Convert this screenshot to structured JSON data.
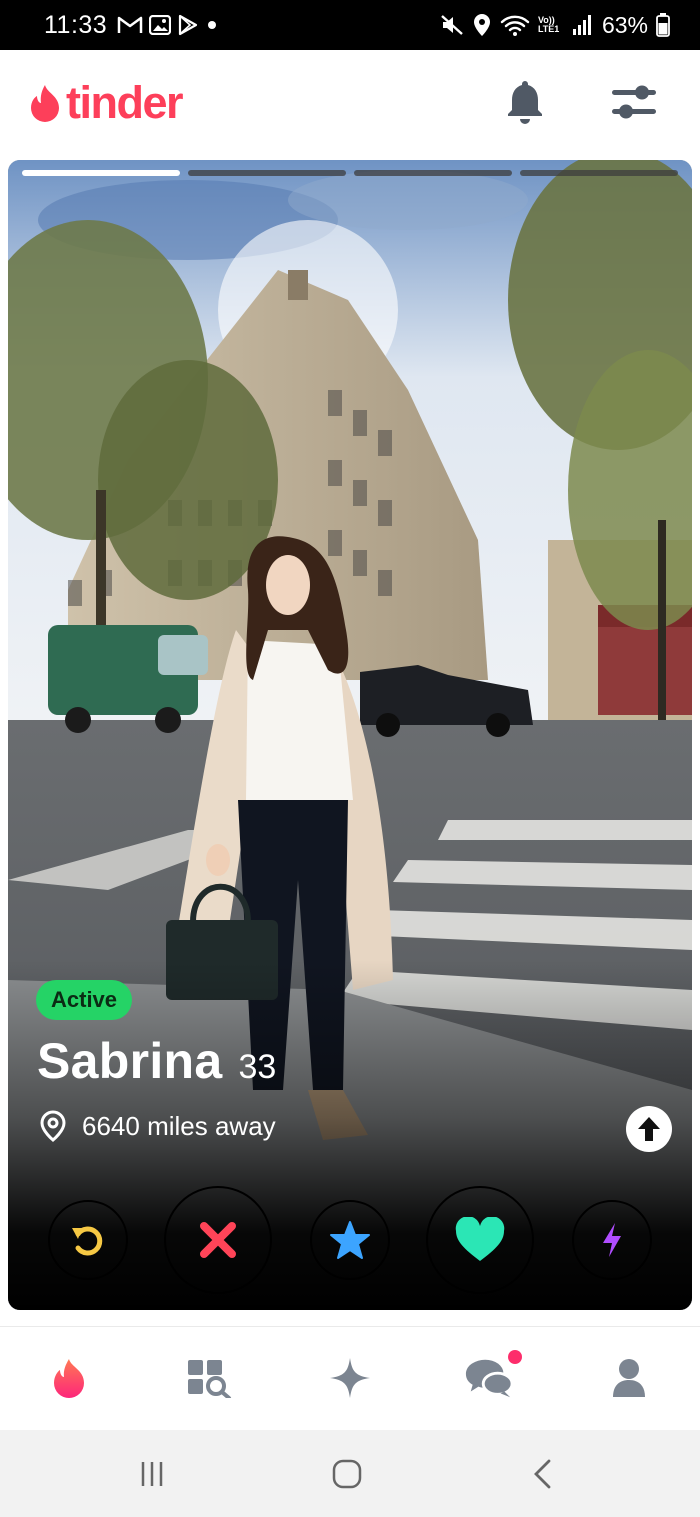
{
  "status_bar": {
    "time": "11:33",
    "network_label": "Vo)) LTE1",
    "battery_percent": "63%"
  },
  "header": {
    "logo_text": "tinder",
    "logo_color": "#fd3f5a",
    "bell_icon": "bell-icon",
    "filter_icon": "sliders-icon"
  },
  "card": {
    "photo_count": 4,
    "active_photo_index": 0,
    "status_badge": "Active",
    "name": "Sabrina",
    "age": "33",
    "distance": "6640 miles away",
    "info_icon": "arrow-up-icon"
  },
  "actions": [
    {
      "name": "rewind",
      "icon": "rewind-icon",
      "color": "#f6c844"
    },
    {
      "name": "nope",
      "icon": "x-icon",
      "color": "#ff4458"
    },
    {
      "name": "super-like",
      "icon": "star-icon",
      "color": "#3ca4ff"
    },
    {
      "name": "like",
      "icon": "heart-icon",
      "color": "#2be6b5"
    },
    {
      "name": "boost",
      "icon": "bolt-icon",
      "color": "#b04dff"
    }
  ],
  "bottom_nav": [
    {
      "name": "home",
      "icon": "flame-icon",
      "active": true
    },
    {
      "name": "explore",
      "icon": "explore-grid-icon",
      "active": false
    },
    {
      "name": "gold",
      "icon": "sparkle-icon",
      "active": false
    },
    {
      "name": "messages",
      "icon": "chat-bubbles-icon",
      "active": false,
      "has_badge": true
    },
    {
      "name": "profile",
      "icon": "person-icon",
      "active": false
    }
  ]
}
